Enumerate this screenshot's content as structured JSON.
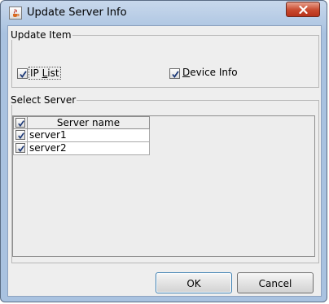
{
  "window": {
    "title": "Update Server Info",
    "close_icon": "close-x-icon",
    "app_icon": "java-cup-icon"
  },
  "update_item": {
    "legend": "Update Item",
    "ip_list": {
      "label_prefix": "IP ",
      "label_mnemonic": "L",
      "label_rest": "ist",
      "checked": true
    },
    "device_info": {
      "label_mnemonic": "D",
      "label_rest": "evice Info",
      "checked": true
    }
  },
  "select_server": {
    "legend": "Select  Server",
    "columns": [
      "",
      "Server name"
    ],
    "header_checked": true,
    "rows": [
      {
        "checked": true,
        "name": "server1"
      },
      {
        "checked": true,
        "name": "server2"
      }
    ]
  },
  "buttons": {
    "ok": "OK",
    "cancel": "Cancel"
  },
  "colors": {
    "title_bar": "#a9c2e0",
    "close_button": "#c8492e",
    "client_bg": "#eeeeee",
    "ok_border": "#3c7fb1"
  }
}
